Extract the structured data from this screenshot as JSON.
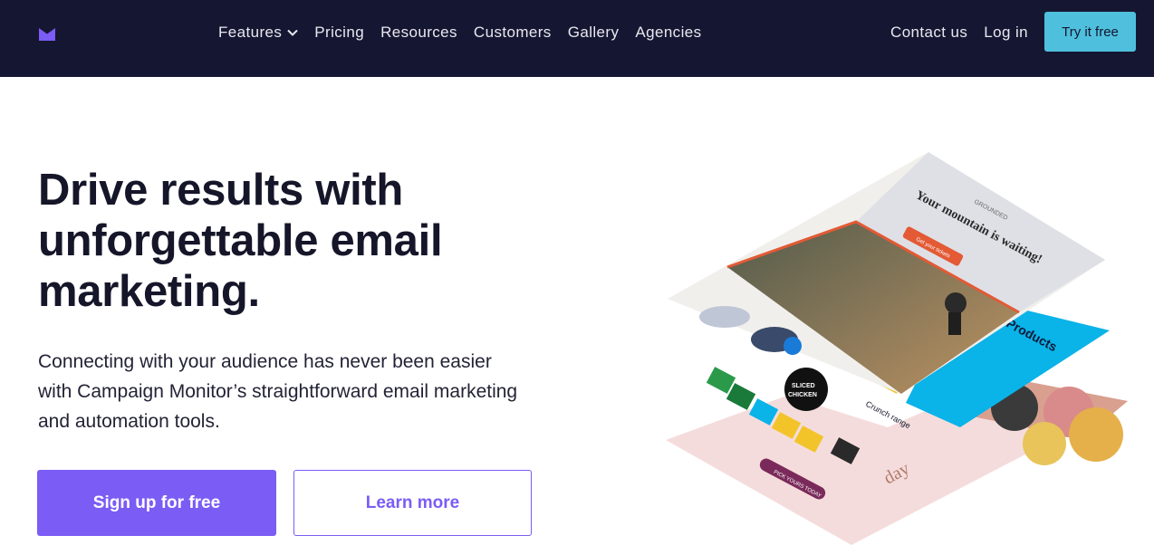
{
  "nav": {
    "items": [
      {
        "label": "Features",
        "has_dropdown": true
      },
      {
        "label": "Pricing"
      },
      {
        "label": "Resources"
      },
      {
        "label": "Customers"
      },
      {
        "label": "Gallery"
      },
      {
        "label": "Agencies"
      }
    ],
    "contact": "Contact us",
    "login": "Log in",
    "try": "Try it free"
  },
  "hero": {
    "headline": "Drive results with unforgettable email marketing.",
    "subtext": "Connecting with your audience has never been easier with Campaign Monitor’s straightforward email marketing and automation tools.",
    "primary_cta": "Sign up for free",
    "secondary_cta": "Learn more"
  },
  "illustration": {
    "brand": "GROUNDED",
    "headline": "Your mountain is waiting!",
    "cta": "Get your tickets",
    "products": "Products",
    "badge_line1": "SLICED",
    "badge_line2": "CHICKEN",
    "range": "Crunch range",
    "bottom_cta": "PICK YOURS TODAY",
    "day_word": "day"
  },
  "colors": {
    "nav_bg": "#151631",
    "accent": "#7b5cf5",
    "try_btn": "#4ec0dd"
  }
}
